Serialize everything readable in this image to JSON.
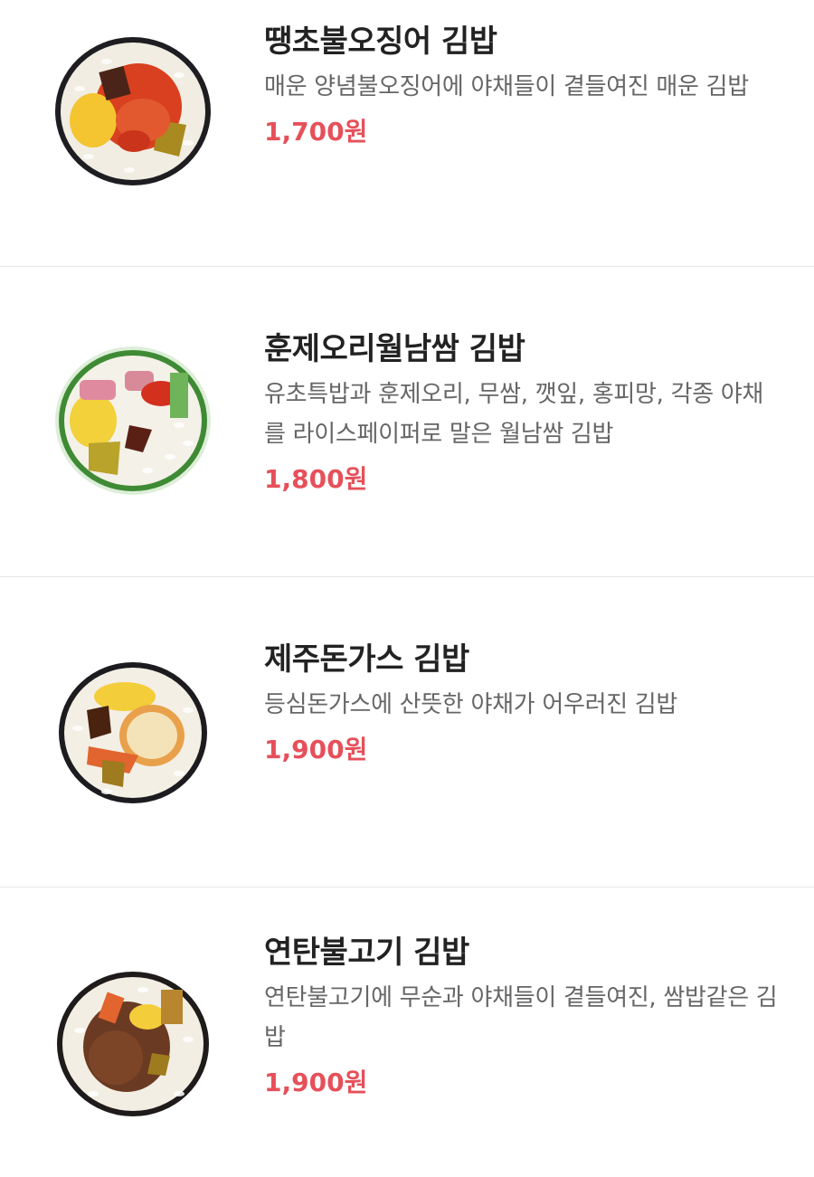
{
  "menu": {
    "items": [
      {
        "name": "땡초불오징어 김밥",
        "description": "매운 양념불오징어에 야채들이 곁들여진 매운 김밥",
        "price": "1,700원",
        "image_icon": "gimbap-squid-image"
      },
      {
        "name": "훈제오리월남쌈 김밥",
        "description": "유초특밥과 훈제오리, 무쌈, 깻잎, 홍피망, 각종 야채를 라이스페이퍼로 말은 월남쌈 김밥",
        "price": "1,800원",
        "image_icon": "gimbap-duck-image"
      },
      {
        "name": "제주돈가스 김밥",
        "description": "등심돈가스에 산뜻한 야채가 어우러진 김밥",
        "price": "1,900원",
        "image_icon": "gimbap-pork-cutlet-image"
      },
      {
        "name": "연탄불고기 김밥",
        "description": "연탄불고기에 무순과 야채들이 곁들여진, 쌈밥같은 김밥",
        "price": "1,900원",
        "image_icon": "gimbap-bulgogi-image"
      }
    ]
  },
  "colors": {
    "price": "#e6505a",
    "title": "#222222",
    "description": "#666666",
    "divider": "#e6e6e6"
  }
}
